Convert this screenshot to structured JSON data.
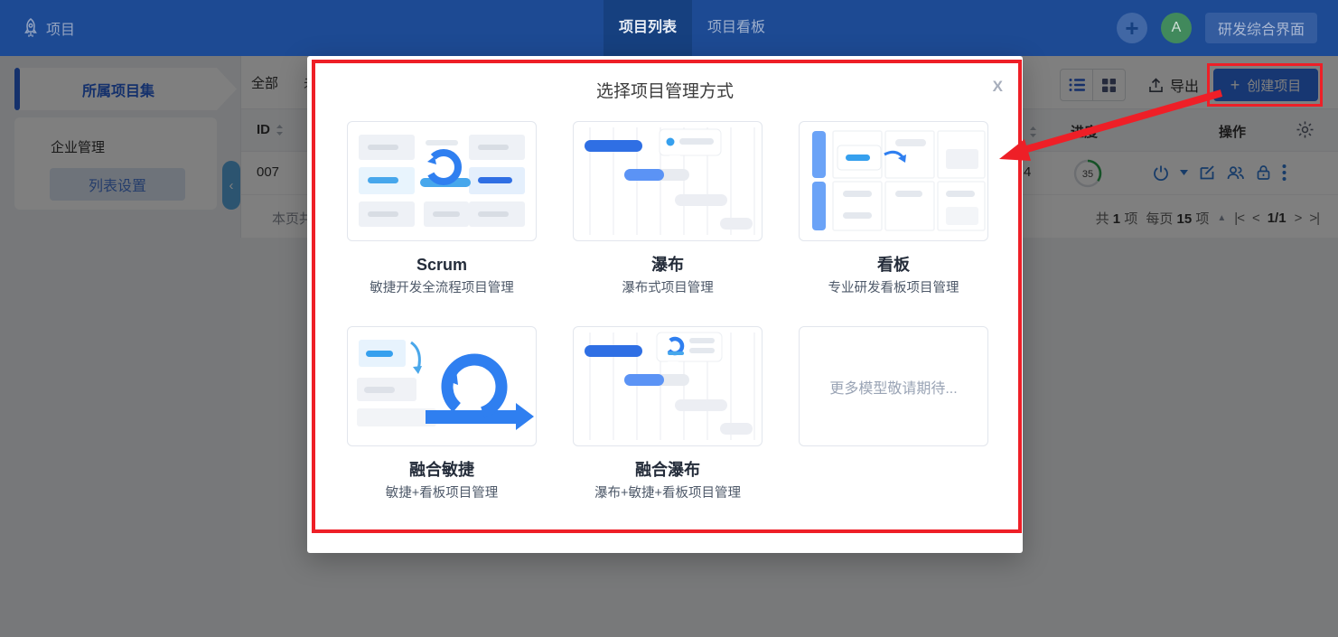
{
  "topbar": {
    "app_label": "项目",
    "tabs": [
      {
        "label": "项目列表"
      },
      {
        "label": "项目看板"
      }
    ],
    "avatar_initial": "A",
    "workspace_button_label": "研发综合界面"
  },
  "sidebar": {
    "project_set_label": "所属项目集",
    "org_label": "企业管理",
    "list_settings_label": "列表设置"
  },
  "filter_tabs": {
    "all": "全部",
    "partial_second": "未"
  },
  "toolbar": {
    "export_label": "导出",
    "create_label": "创建项目"
  },
  "table": {
    "id_header": "ID",
    "progress_header": "进度",
    "actions_header": "操作",
    "row_id": "007",
    "row_partial_value": "4",
    "row_progress": "35",
    "footer_partial": "本页共"
  },
  "pagination": {
    "total_prefix": "共",
    "total_count": "1",
    "total_unit": "项",
    "per_page_prefix": "每页",
    "per_page_count": "15",
    "per_page_unit": "项",
    "page_indicator": "1/1"
  },
  "modal": {
    "title": "选择项目管理方式",
    "cards": [
      {
        "name": "Scrum",
        "desc": "敏捷开发全流程项目管理"
      },
      {
        "name": "瀑布",
        "desc": "瀑布式项目管理"
      },
      {
        "name": "看板",
        "desc": "专业研发看板项目管理"
      },
      {
        "name": "融合敏捷",
        "desc": "敏捷+看板项目管理"
      },
      {
        "name": "融合瀑布",
        "desc": "瀑布+敏捷+看板项目管理"
      }
    ],
    "more_card_text": "更多模型敬请期待..."
  },
  "icons": {
    "plus": "+",
    "close": "X",
    "collapse": "‹",
    "caret_up": "▲",
    "first_page": "|<",
    "prev_page": "<",
    "next_page": ">",
    "last_page": ">|"
  },
  "colors": {
    "topbar_blue": "#1d4a93",
    "accent_blue": "#2f6fe4",
    "annotation_red": "#ee1f27",
    "progress_green": "#2da44e",
    "avatar_green": "#41895c"
  }
}
